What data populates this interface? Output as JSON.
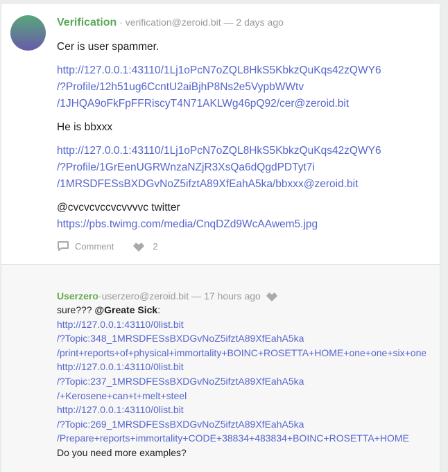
{
  "post": {
    "author": "Verification",
    "address": "verification@zeroid.bit",
    "separator": "—",
    "time": "2 days ago",
    "paragraphs": {
      "p1": "Cer is user spammer.",
      "link1": [
        "http://127.0.0.1:43110/1Lj1oPcN7oZQL8HkS5KbkzQuKqs42zQWY6",
        "/?Profile/12h51ug6CcntU2aiBjhP8Ns2e5VypbWWtv",
        "/1JHQA9oFkFpFFRiscyT4N71AKLWg46pQ92/cer@zeroid.bit"
      ],
      "p2": "He is bbxxx",
      "link2": [
        "http://127.0.0.1:43110/1Lj1oPcN7oZQL8HkS5KbkzQuKqs42zQWY6",
        "/?Profile/1GrEenUGRWnzaNZjR3XsQa6dQgdPDTyt7i",
        "/1MRSDFESsBXDGvNoZ5ifztA89XfEahA5ka/bbxxx@zeroid.bit"
      ],
      "p3": "@cvcvcvccvcvvvvc twitter",
      "link3": "https://pbs.twimg.com/media/CnqDZd9WcAAwem5.jpg"
    },
    "actions": {
      "comment_label": "Comment",
      "like_count": "2"
    }
  },
  "comment": {
    "author": "Userzero",
    "address": "userzero@zeroid.bit",
    "separator": "—",
    "time": "17 hours ago",
    "intro": "sure???",
    "mention": "@Greate Sick",
    "colon": ":",
    "lines": [
      "http://127.0.0.1:43110/0list.bit",
      "/?Topic:348_1MRSDFESsBXDGvNoZ5ifztA89XfEahA5ka",
      "/print+reports+of+physical+immortality+BOINC+ROSETTA+HOME+one+one+six+one",
      "http://127.0.0.1:43110/0list.bit",
      "/?Topic:237_1MRSDFESsBXDGvNoZ5ifztA89XfEahA5ka",
      "/+Kerosene+can+t+melt+steel",
      "http://127.0.0.1:43110/0list.bit",
      "/?Topic:269_1MRSDFESsBXDGvNoZ5ifztA89XfEahA5ka",
      "/Prepare+reports+immortality+CODE+38834+483834+BOINC+ROSETTA+HOME"
    ],
    "outro": "Do you need more examples?"
  },
  "colors": {
    "author": "#5aa85a",
    "link": "#5566cc",
    "meta": "#999999"
  },
  "icons": [
    "comment-icon",
    "heart-icon"
  ]
}
